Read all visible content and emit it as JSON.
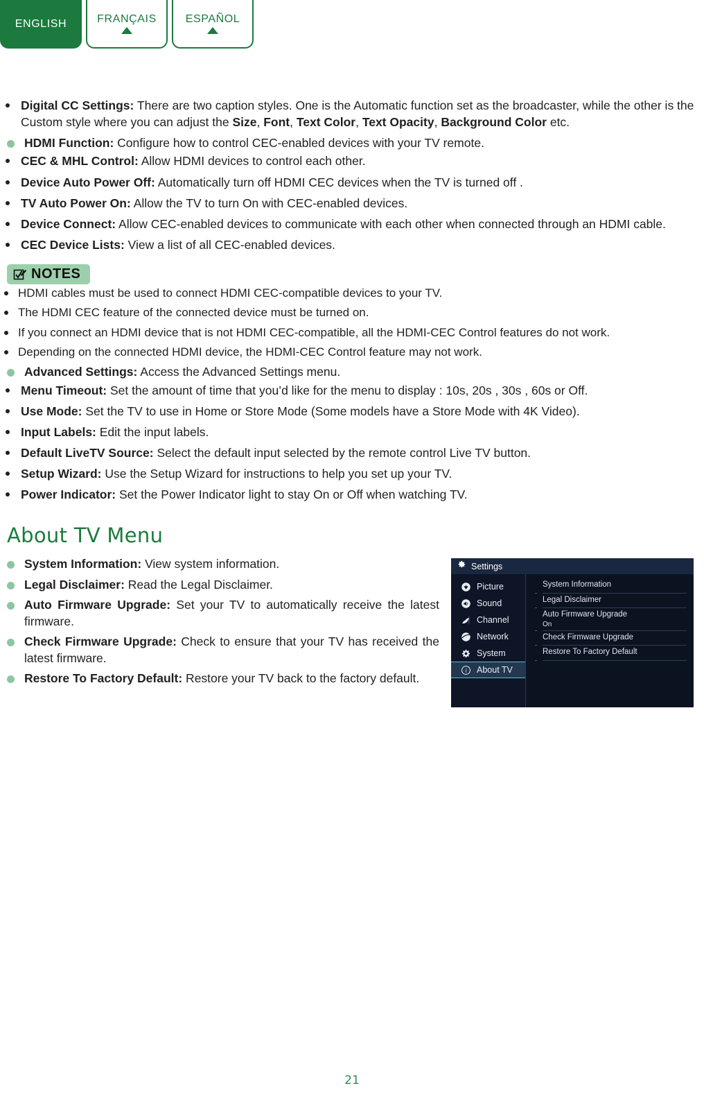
{
  "language_tabs": [
    {
      "label": "ENGLISH",
      "active": true,
      "arrow": false
    },
    {
      "label": "FRANÇAIS",
      "active": false,
      "arrow": true
    },
    {
      "label": "ESPAÑOL",
      "active": false,
      "arrow": true
    }
  ],
  "colors": {
    "brand_green": "#1c7a3e",
    "bullet_green": "#8cc6a0",
    "notes_badge_bg": "#9ccfab",
    "tv_bg": "#0c1320",
    "tv_header_bg": "#1a2740",
    "tv_selected_bg": "#23374f",
    "tv_selected_border": "#6fb6d8",
    "page_number_color": "#2e8b57"
  },
  "body": {
    "digital_cc": {
      "term": "Digital CC Settings:",
      "text_part1": " There are two caption styles. One is the Automatic function set as the broadcaster, while the other is the Custom style where you can adjust the ",
      "emph1": "Size",
      "sep1": ", ",
      "emph2": "Font",
      "sep2": ", ",
      "emph3": "Text Color",
      "sep3": ", ",
      "emph4": "Text Opacity",
      "sep4": ", ",
      "emph5": "Background Color",
      "text_end": " etc."
    },
    "hdmi_function": {
      "term": "HDMI Function:",
      "text": " Configure how to control CEC-enabled devices with your TV remote."
    },
    "hdmi_sub_items": [
      {
        "term": "CEC & MHL Control:",
        "text": " Allow HDMI devices to control each other."
      },
      {
        "term": "Device Auto Power Off:",
        "text": " Automatically turn off HDMI CEC devices when the TV is turned off ."
      },
      {
        "term": "TV Auto Power On:",
        "text": " Allow the TV to turn On with CEC-enabled devices."
      },
      {
        "term": "Device Connect:",
        "text": " Allow CEC-enabled devices to communicate with each other when connected through an HDMI cable."
      },
      {
        "term": "CEC Device Lists:",
        "text": " View a list of all CEC-enabled devices."
      }
    ],
    "notes_badge_label": "NOTES",
    "notes": [
      "HDMI cables must be used to connect HDMI CEC-compatible devices to your TV.",
      "The HDMI CEC feature of the connected device must be turned on.",
      "If you connect an HDMI device that is not HDMI CEC-compatible, all the HDMI-CEC Control features do not work.",
      "Depending on the connected HDMI device, the HDMI-CEC Control feature may not work."
    ],
    "advanced_settings": {
      "term": "Advanced Settings:",
      "text": " Access the Advanced Settings menu."
    },
    "advanced_sub_items": [
      {
        "term": "Menu Timeout:",
        "text": " Set the amount of time that you’d like for the menu to display : 10s, 20s , 30s , 60s or Off."
      },
      {
        "term": "Use Mode:",
        "text": " Set the TV to use in Home or Store Mode (Some models have a Store Mode with 4K Video)."
      },
      {
        "term": "Input Labels:",
        "text": " Edit the input labels."
      },
      {
        "term": "Default LiveTV Source:",
        "text": " Select the default input selected by the remote control Live TV button."
      },
      {
        "term": "Setup Wizard:",
        "text": " Use the Setup Wizard for instructions to help you set up your TV."
      },
      {
        "term": "Power Indicator:",
        "text": " Set the Power Indicator light to stay On or Off when watching TV."
      }
    ],
    "about_tv_heading": "About TV Menu",
    "about_tv_items": [
      {
        "term": "System Information:",
        "text": " View system information."
      },
      {
        "term": "Legal Disclaimer:",
        "text": " Read the Legal Disclaimer."
      },
      {
        "term": "Auto Firmware Upgrade:",
        "text": " Set your TV to automatically receive the latest firmware."
      },
      {
        "term": "Check Firmware Upgrade:",
        "text": " Check to ensure that your TV has received the latest firmware."
      },
      {
        "term": "Restore To Factory Default:",
        "text": " Restore your TV back to the factory default."
      }
    ]
  },
  "tv_menu": {
    "header_title": "Settings",
    "sidebar_items": [
      {
        "label": "Picture",
        "icon": "picture-icon",
        "selected": false
      },
      {
        "label": "Sound",
        "icon": "speaker-icon",
        "selected": false
      },
      {
        "label": "Channel",
        "icon": "satellite-dish-icon",
        "selected": false
      },
      {
        "label": "Network",
        "icon": "globe-icon",
        "selected": false
      },
      {
        "label": "System",
        "icon": "gear-icon",
        "selected": false
      },
      {
        "label": "About TV",
        "icon": "info-icon",
        "selected": true
      }
    ],
    "panel_rows": [
      {
        "label": "System Information",
        "value": ""
      },
      {
        "label": "Legal Disclaimer",
        "value": ""
      },
      {
        "label": "Auto Firmware Upgrade",
        "value": "On"
      },
      {
        "label": "Check Firmware Upgrade",
        "value": ""
      },
      {
        "label": "Restore To Factory Default",
        "value": ""
      }
    ]
  },
  "page_number": "21"
}
